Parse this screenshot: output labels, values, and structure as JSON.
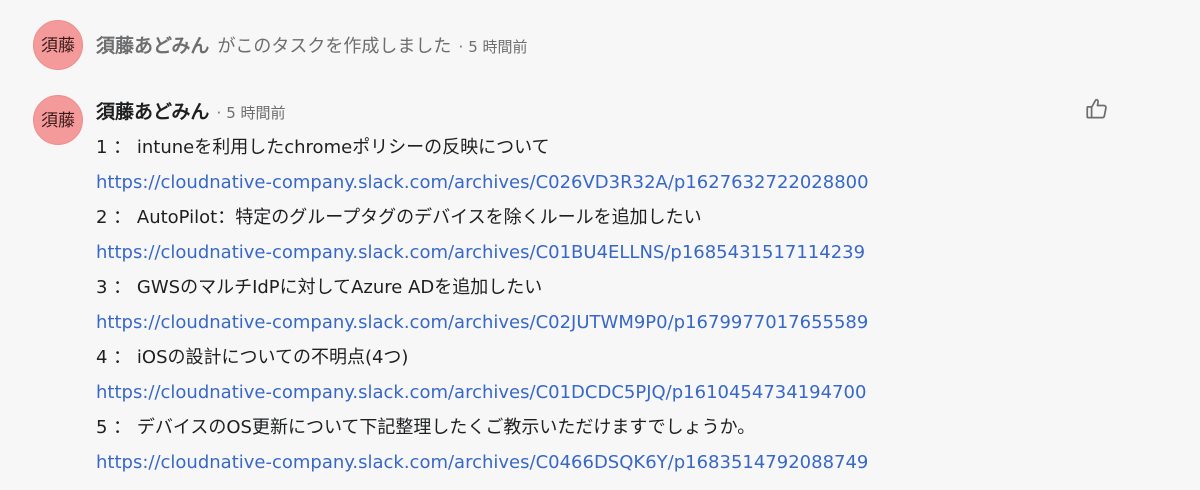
{
  "story": {
    "avatar_initials": "須藤",
    "author": "須藤あどみん",
    "text": "がこのタスクを作成しました",
    "separator": "·",
    "time": "5 時間前"
  },
  "comment": {
    "avatar_initials": "須藤",
    "author": "須藤あどみん",
    "separator": "·",
    "time": "5 時間前",
    "like_icon": "thumbs-up-icon",
    "items": [
      {
        "text": "1 ： intuneを利用したchromeポリシーの反映について",
        "url": "https://cloudnative-company.slack.com/archives/C026VD3R32A/p1627632722028800"
      },
      {
        "text": "2 ： AutoPilot：特定のグループタグのデバイスを除くルールを追加したい",
        "url": "https://cloudnative-company.slack.com/archives/C01BU4ELLNS/p1685431517114239"
      },
      {
        "text": "3 ： GWSのマルチIdPに対してAzure ADを追加したい",
        "url": "https://cloudnative-company.slack.com/archives/C02JUTWM9P0/p1679977017655589"
      },
      {
        "text": "4 ： iOSの設計についての不明点(4つ)",
        "url": "https://cloudnative-company.slack.com/archives/C01DCDC5PJQ/p1610454734194700"
      },
      {
        "text": "5 ： デバイスのOS更新について下記整理したくご教示いただけますでしょうか。",
        "url": "https://cloudnative-company.slack.com/archives/C0466DSQK6Y/p168351479208874 9"
      }
    ]
  },
  "colors": {
    "background": "#f7f7f7",
    "avatar": "#f49a9a",
    "link": "#3768c8",
    "muted_text": "#6d6e6f"
  }
}
